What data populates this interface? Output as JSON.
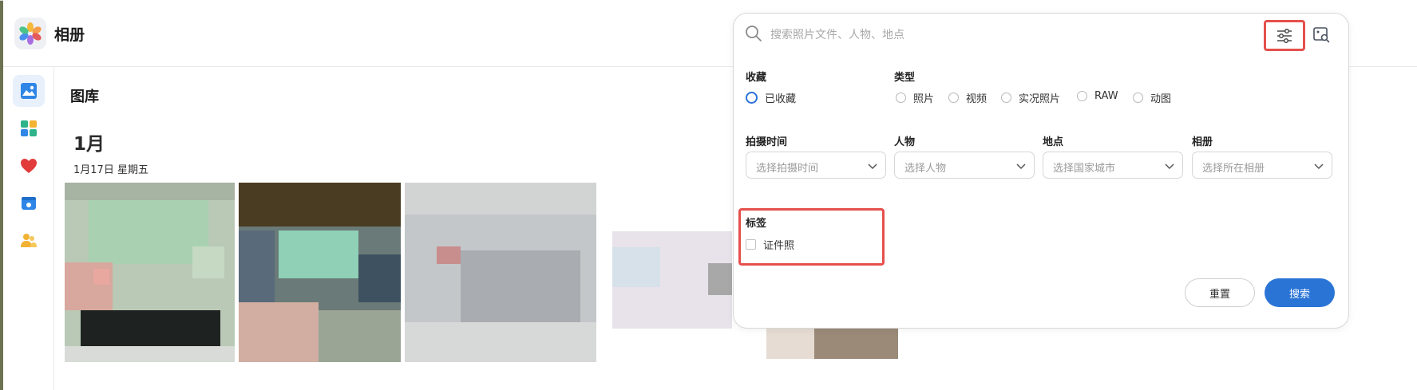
{
  "app": {
    "title": "相册"
  },
  "main": {
    "title": "图库",
    "month": "1月",
    "date_line": "1月17日 星期五"
  },
  "sidebar": {
    "items": [
      {
        "icon": "photo-library-icon",
        "active": true
      },
      {
        "icon": "albums-icon",
        "active": false
      },
      {
        "icon": "favorites-heart-icon",
        "active": false
      },
      {
        "icon": "memories-icon",
        "active": false
      },
      {
        "icon": "people-icon",
        "active": false
      }
    ]
  },
  "search": {
    "placeholder": "搜索照片文件、人物、地点",
    "value": ""
  },
  "filters": {
    "favorites": {
      "label": "收藏",
      "option": "已收藏"
    },
    "type": {
      "label": "类型",
      "options": [
        "照片",
        "视频",
        "实况照片",
        "RAW",
        "动图"
      ]
    },
    "shot_time": {
      "label": "拍摄时间",
      "placeholder": "选择拍摄时间"
    },
    "people": {
      "label": "人物",
      "placeholder": "选择人物"
    },
    "location": {
      "label": "地点",
      "placeholder": "选择国家城市"
    },
    "album": {
      "label": "相册",
      "placeholder": "选择所在相册"
    },
    "tags": {
      "label": "标签",
      "option": "证件照"
    }
  },
  "actions": {
    "reset": "重置",
    "search": "搜索"
  },
  "colors": {
    "accent": "#2a74d6",
    "highlight": "#e5504c"
  }
}
